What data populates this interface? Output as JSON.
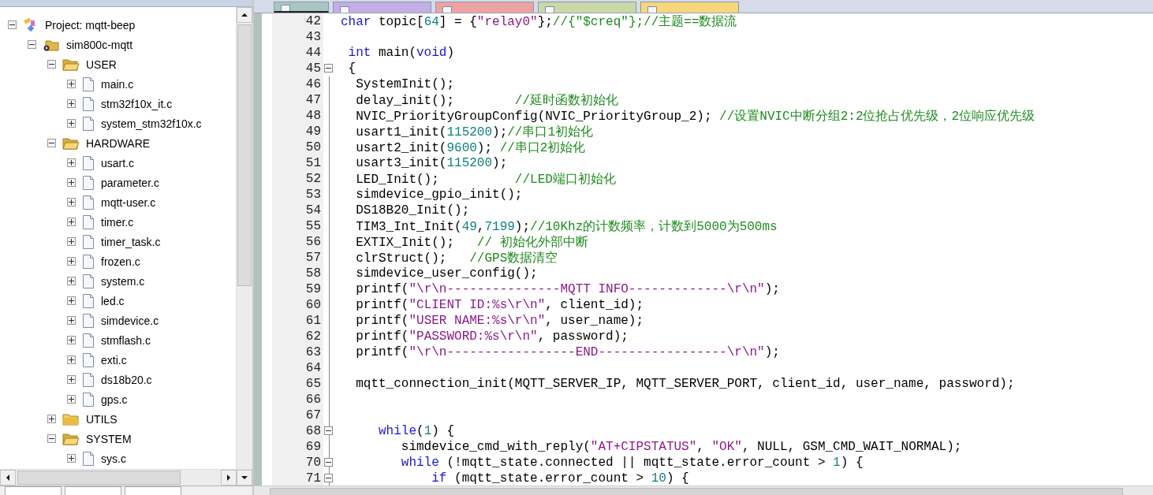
{
  "project_panel": {
    "tree": [
      {
        "label": "Project: mqtt-beep",
        "kind": "project",
        "expanded": true,
        "children": [
          {
            "label": "sim800c-mqtt",
            "kind": "target",
            "expanded": true,
            "children": [
              {
                "label": "USER",
                "kind": "group",
                "expanded": true,
                "children": [
                  {
                    "label": "main.c",
                    "kind": "file",
                    "expanded": false
                  },
                  {
                    "label": "stm32f10x_it.c",
                    "kind": "file",
                    "expanded": false
                  },
                  {
                    "label": "system_stm32f10x.c",
                    "kind": "file",
                    "expanded": false
                  }
                ]
              },
              {
                "label": "HARDWARE",
                "kind": "group",
                "expanded": true,
                "children": [
                  {
                    "label": "usart.c",
                    "kind": "file",
                    "expanded": false
                  },
                  {
                    "label": "parameter.c",
                    "kind": "file",
                    "expanded": false
                  },
                  {
                    "label": "mqtt-user.c",
                    "kind": "file",
                    "expanded": false
                  },
                  {
                    "label": "timer.c",
                    "kind": "file",
                    "expanded": false
                  },
                  {
                    "label": "timer_task.c",
                    "kind": "file",
                    "expanded": false
                  },
                  {
                    "label": "frozen.c",
                    "kind": "file",
                    "expanded": false
                  },
                  {
                    "label": "system.c",
                    "kind": "file",
                    "expanded": false
                  },
                  {
                    "label": "led.c",
                    "kind": "file",
                    "expanded": false
                  },
                  {
                    "label": "simdevice.c",
                    "kind": "file",
                    "expanded": false
                  },
                  {
                    "label": "stmflash.c",
                    "kind": "file",
                    "expanded": false
                  },
                  {
                    "label": "exti.c",
                    "kind": "file",
                    "expanded": false
                  },
                  {
                    "label": "ds18b20.c",
                    "kind": "file",
                    "expanded": false
                  },
                  {
                    "label": "gps.c",
                    "kind": "file",
                    "expanded": false
                  }
                ]
              },
              {
                "label": "UTILS",
                "kind": "group",
                "expanded": false
              },
              {
                "label": "SYSTEM",
                "kind": "group",
                "expanded": true,
                "children": [
                  {
                    "label": "sys.c",
                    "kind": "file",
                    "expanded": false
                  }
                ]
              }
            ]
          }
        ]
      }
    ]
  },
  "editor": {
    "tabs": [
      {
        "selected": true,
        "color": "#a9c7c2"
      },
      {
        "selected": false,
        "color": "#c3aee6"
      },
      {
        "selected": false,
        "color": "#eea3a3"
      },
      {
        "selected": false,
        "color": "#c9d9a9"
      },
      {
        "selected": false,
        "color": "#f7d77c"
      }
    ],
    "lines": [
      {
        "number": "42",
        "fold": false,
        "tokens": [
          {
            "kind": "keyword",
            "text": "char"
          },
          {
            "kind": "plain",
            "text": " topic["
          },
          {
            "kind": "number",
            "text": "64"
          },
          {
            "kind": "plain",
            "text": "] = {"
          },
          {
            "kind": "string",
            "text": "\"relay0\""
          },
          {
            "kind": "plain",
            "text": "};"
          },
          {
            "kind": "comment",
            "text": "//{\"$creq\"};//主题==数据流"
          }
        ]
      },
      {
        "number": "43",
        "fold": false
      },
      {
        "number": "44",
        "fold": false,
        "tokens": [
          {
            "kind": "keyword",
            "text": " int"
          },
          {
            "kind": "plain",
            "text": " main("
          },
          {
            "kind": "keyword",
            "text": "void"
          },
          {
            "kind": "plain",
            "text": ")"
          }
        ]
      },
      {
        "number": "45",
        "fold": true,
        "tokens": [
          {
            "kind": "plain",
            "text": " {"
          }
        ]
      },
      {
        "number": "46",
        "fold": false,
        "tokens": [
          {
            "kind": "plain",
            "text": "  SystemInit();"
          }
        ]
      },
      {
        "number": "47",
        "fold": false,
        "tokens": [
          {
            "kind": "plain",
            "text": "  delay_init();        "
          },
          {
            "kind": "comment",
            "text": "//延时函数初始化"
          }
        ]
      },
      {
        "number": "48",
        "fold": false,
        "tokens": [
          {
            "kind": "plain",
            "text": "  NVIC_PriorityGroupConfig(NVIC_PriorityGroup_2); "
          },
          {
            "kind": "comment",
            "text": "//设置NVIC中断分组2:2位抢占优先级，2位响应优先级"
          }
        ]
      },
      {
        "number": "49",
        "fold": false,
        "tokens": [
          {
            "kind": "plain",
            "text": "  usart1_init("
          },
          {
            "kind": "number",
            "text": "115200"
          },
          {
            "kind": "plain",
            "text": ");"
          },
          {
            "kind": "comment",
            "text": "//串口1初始化"
          }
        ]
      },
      {
        "number": "50",
        "fold": false,
        "tokens": [
          {
            "kind": "plain",
            "text": "  usart2_init("
          },
          {
            "kind": "number",
            "text": "9600"
          },
          {
            "kind": "plain",
            "text": "); "
          },
          {
            "kind": "comment",
            "text": "//串口2初始化"
          }
        ]
      },
      {
        "number": "51",
        "fold": false,
        "tokens": [
          {
            "kind": "plain",
            "text": "  usart3_init("
          },
          {
            "kind": "number",
            "text": "115200"
          },
          {
            "kind": "plain",
            "text": ");"
          }
        ]
      },
      {
        "number": "52",
        "fold": false,
        "tokens": [
          {
            "kind": "plain",
            "text": "  LED_Init();          "
          },
          {
            "kind": "comment",
            "text": "//LED端口初始化"
          }
        ]
      },
      {
        "number": "53",
        "fold": false,
        "tokens": [
          {
            "kind": "plain",
            "text": "  simdevice_gpio_init();"
          }
        ]
      },
      {
        "number": "54",
        "fold": false,
        "tokens": [
          {
            "kind": "plain",
            "text": "  DS18B20_Init();"
          }
        ]
      },
      {
        "number": "55",
        "fold": false,
        "tokens": [
          {
            "kind": "plain",
            "text": "  TIM3_Int_Init("
          },
          {
            "kind": "number",
            "text": "49"
          },
          {
            "kind": "plain",
            "text": ","
          },
          {
            "kind": "number",
            "text": "7199"
          },
          {
            "kind": "plain",
            "text": ");"
          },
          {
            "kind": "comment",
            "text": "//10Khz的计数频率，计数到5000为500ms"
          }
        ]
      },
      {
        "number": "56",
        "fold": false,
        "tokens": [
          {
            "kind": "plain",
            "text": "  EXTIX_Init();   "
          },
          {
            "kind": "comment",
            "text": "// 初始化外部中断"
          }
        ]
      },
      {
        "number": "57",
        "fold": false,
        "tokens": [
          {
            "kind": "plain",
            "text": "  clrStruct();   "
          },
          {
            "kind": "comment",
            "text": "//GPS数据清空"
          }
        ]
      },
      {
        "number": "58",
        "fold": false,
        "tokens": [
          {
            "kind": "plain",
            "text": "  simdevice_user_config();"
          }
        ]
      },
      {
        "number": "59",
        "fold": false,
        "tokens": [
          {
            "kind": "plain",
            "text": "  printf("
          },
          {
            "kind": "string",
            "text": "\"\\r\\n---------------MQTT INFO-------------\\r\\n\""
          },
          {
            "kind": "plain",
            "text": ");"
          }
        ]
      },
      {
        "number": "60",
        "fold": false,
        "tokens": [
          {
            "kind": "plain",
            "text": "  printf("
          },
          {
            "kind": "string",
            "text": "\"CLIENT ID:%s\\r\\n\""
          },
          {
            "kind": "plain",
            "text": ", client_id);"
          }
        ]
      },
      {
        "number": "61",
        "fold": false,
        "tokens": [
          {
            "kind": "plain",
            "text": "  printf("
          },
          {
            "kind": "string",
            "text": "\"USER NAME:%s\\r\\n\""
          },
          {
            "kind": "plain",
            "text": ", user_name);"
          }
        ]
      },
      {
        "number": "62",
        "fold": false,
        "tokens": [
          {
            "kind": "plain",
            "text": "  printf("
          },
          {
            "kind": "string",
            "text": "\"PASSWORD:%s\\r\\n\""
          },
          {
            "kind": "plain",
            "text": ", password);"
          }
        ]
      },
      {
        "number": "63",
        "fold": false,
        "tokens": [
          {
            "kind": "plain",
            "text": "  printf("
          },
          {
            "kind": "string",
            "text": "\"\\r\\n-----------------END-----------------\\r\\n\""
          },
          {
            "kind": "plain",
            "text": ");"
          }
        ]
      },
      {
        "number": "64",
        "fold": false
      },
      {
        "number": "65",
        "fold": false,
        "tokens": [
          {
            "kind": "plain",
            "text": "  mqtt_connection_init(MQTT_SERVER_IP, MQTT_SERVER_PORT, client_id, user_name, password);"
          }
        ]
      },
      {
        "number": "66",
        "fold": false
      },
      {
        "number": "67",
        "fold": false
      },
      {
        "number": "68",
        "fold": true,
        "tokens": [
          {
            "kind": "keyword",
            "text": "     while"
          },
          {
            "kind": "plain",
            "text": "("
          },
          {
            "kind": "number",
            "text": "1"
          },
          {
            "kind": "plain",
            "text": ") {"
          }
        ]
      },
      {
        "number": "69",
        "fold": false,
        "tokens": [
          {
            "kind": "plain",
            "text": "        simdevice_cmd_with_reply("
          },
          {
            "kind": "string",
            "text": "\"AT+CIPSTATUS\""
          },
          {
            "kind": "plain",
            "text": ", "
          },
          {
            "kind": "string",
            "text": "\"OK\""
          },
          {
            "kind": "plain",
            "text": ", NULL, GSM_CMD_WAIT_NORMAL);"
          }
        ]
      },
      {
        "number": "70",
        "fold": true,
        "tokens": [
          {
            "kind": "keyword",
            "text": "        while"
          },
          {
            "kind": "plain",
            "text": " (!mqtt_state.connected || mqtt_state.error_count > "
          },
          {
            "kind": "number",
            "text": "1"
          },
          {
            "kind": "plain",
            "text": ") {"
          }
        ]
      },
      {
        "number": "71",
        "fold": true,
        "tokens": [
          {
            "kind": "keyword",
            "text": "            if"
          },
          {
            "kind": "plain",
            "text": " (mqtt_state.error_count > "
          },
          {
            "kind": "number",
            "text": "10"
          },
          {
            "kind": "plain",
            "text": ") {"
          }
        ]
      }
    ]
  }
}
